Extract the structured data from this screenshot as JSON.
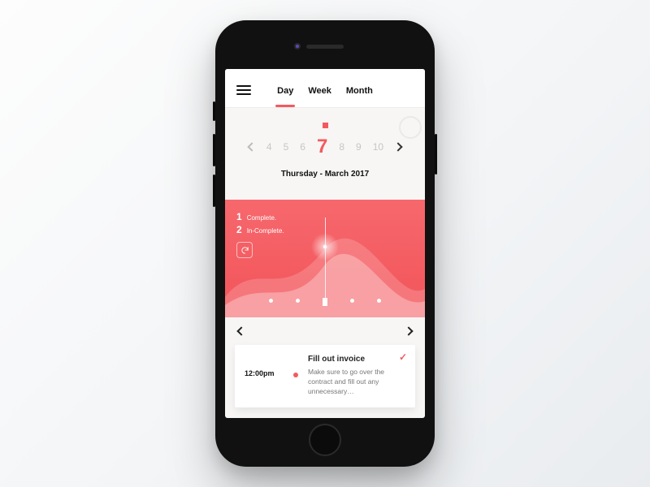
{
  "colors": {
    "accent": "#f35a5f"
  },
  "header": {
    "tabs": [
      {
        "label": "Day",
        "active": true
      },
      {
        "label": "Week",
        "active": false
      },
      {
        "label": "Month",
        "active": false
      }
    ]
  },
  "date_strip": {
    "days": [
      "4",
      "5",
      "6",
      "7",
      "8",
      "9",
      "10"
    ],
    "selected_index": 3,
    "caption": "Thursday - March 2017"
  },
  "panel": {
    "legend": [
      {
        "count": "1",
        "label": "Complete."
      },
      {
        "count": "2",
        "label": "In-Complete."
      }
    ],
    "dot_count": 5
  },
  "task": {
    "time": "12:00pm",
    "title": "Fill out invoice",
    "desc": "Make sure to go over the contract and fill out any unnecessary…",
    "done": true
  }
}
